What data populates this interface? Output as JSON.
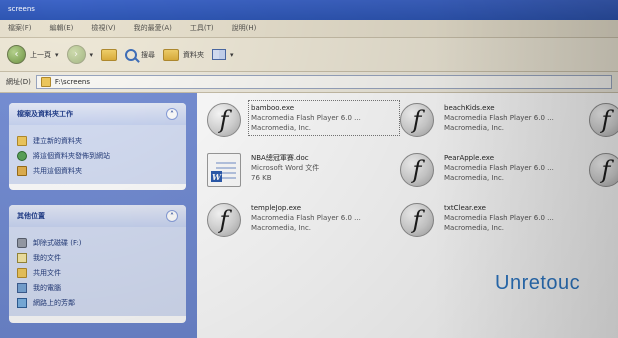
{
  "window": {
    "title": "screens"
  },
  "menubar": {
    "items": [
      "檔案(F)",
      "編輯(E)",
      "檢視(V)",
      "我的最愛(A)",
      "工具(T)",
      "說明(H)"
    ]
  },
  "toolbar": {
    "back_label": "上一頁",
    "search_label": "搜尋",
    "folders_label": "資料夾",
    "views_label": "檢視"
  },
  "addressbar": {
    "label": "網址(D)",
    "path": "F:\\screens"
  },
  "sidebar": {
    "tasks_title": "檔案及資料夾工作",
    "tasks": [
      {
        "label": "建立新的資料夾",
        "icon": "new-folder-icon"
      },
      {
        "label": "將這個資料夾發佈到網站",
        "icon": "web-publish-icon"
      },
      {
        "label": "共用這個資料夾",
        "icon": "share-folder-icon"
      }
    ],
    "other_title": "其他位置",
    "other": [
      {
        "label": "卸除式磁碟 (F:)",
        "icon": "drive-icon"
      },
      {
        "label": "我的文件",
        "icon": "documents-icon"
      },
      {
        "label": "共用文件",
        "icon": "shared-docs-icon"
      },
      {
        "label": "我的電腦",
        "icon": "computer-icon"
      },
      {
        "label": "網路上的芳鄰",
        "icon": "network-icon"
      }
    ]
  },
  "files": [
    {
      "name": "bamboo.exe",
      "desc": "Macromedia Flash Player 6.0 ...",
      "company": "Macromedia, Inc.",
      "icon": "flash-icon",
      "selected": true
    },
    {
      "name": "beachKids.exe",
      "desc": "Macromedia Flash Player 6.0 ...",
      "company": "Macromedia, Inc.",
      "icon": "flash-icon",
      "selected": false
    },
    {
      "name": "NBA總冠軍賽.doc",
      "desc": "Microsoft Word 文件",
      "company": "76 KB",
      "icon": "word-doc-icon",
      "selected": false
    },
    {
      "name": "PearApple.exe",
      "desc": "Macromedia Flash Player 6.0 ...",
      "company": "Macromedia, Inc.",
      "icon": "flash-icon",
      "selected": false
    },
    {
      "name": "templeJop.exe",
      "desc": "Macromedia Flash Player 6.0 ...",
      "company": "Macromedia, Inc.",
      "icon": "flash-icon",
      "selected": false
    },
    {
      "name": "txtClear.exe",
      "desc": "Macromedia Flash Player 6.0 ...",
      "company": "Macromedia, Inc.",
      "icon": "flash-icon",
      "selected": false
    }
  ],
  "overlay": {
    "text": "Unretouc"
  }
}
